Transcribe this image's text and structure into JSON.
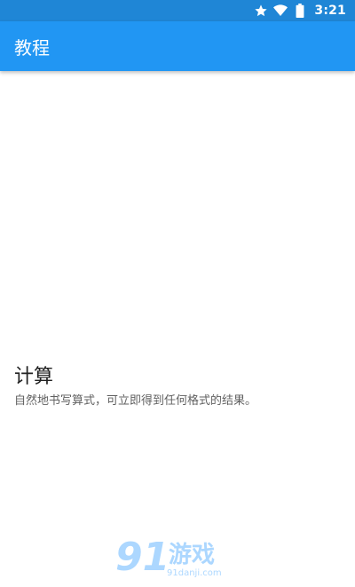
{
  "status_bar": {
    "time": "3:21",
    "icons": [
      "star-icon",
      "wifi-icon",
      "battery-icon"
    ]
  },
  "app_bar": {
    "title": "教程"
  },
  "section": {
    "title": "计算",
    "description": "自然地书写算式，可立即得到任何格式的结果。"
  },
  "watermark": {
    "logo": "91",
    "name": "游戏",
    "url": "91danji.com"
  },
  "colors": {
    "status_bar": "#1f86d6",
    "app_bar": "#2196f3",
    "background": "#ffffff"
  }
}
